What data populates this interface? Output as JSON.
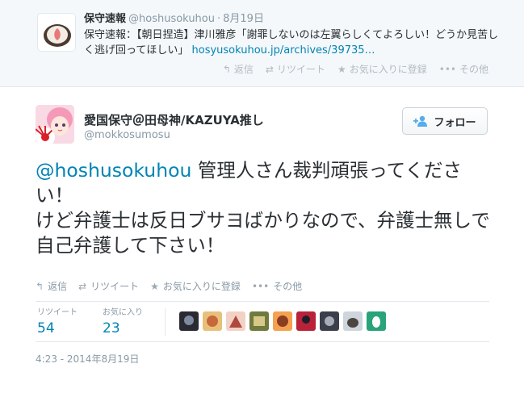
{
  "parent_tweet": {
    "name": "保守速報",
    "handle": "@hoshusokuhou",
    "separator": "·",
    "time": "8月19日",
    "text_before_link": "保守速報：【朝日捏造】津川雅彦「謝罪しないのは左翼らしくてよろしい！どうか見苦しく逃げ回ってほしい」",
    "link_text": "hosyusokuhou.jp/archives/39735…",
    "actions": {
      "reply": "返信",
      "retweet": "リツイート",
      "favorite": "お気に入りに登録",
      "more": "その他"
    }
  },
  "main_tweet": {
    "name": "愛国保守＠田母神/KAZUYA推し",
    "handle": "@mokkosumosu",
    "follow_label": "フォロー",
    "mention": "@hoshusokuhou",
    "text_after_mention": " 管理人さん裁判頑張ってください！",
    "text_line_2": "けど弁護士は反日ブサヨばかりなので、弁護士無しで自己弁護して下さい！",
    "actions": {
      "reply": "返信",
      "retweet": "リツイート",
      "favorite": "お気に入りに登録",
      "more": "その他"
    },
    "stats": {
      "retweets_label": "リツイート",
      "retweets_count": "54",
      "favorites_label": "お気に入り",
      "favorites_count": "23"
    },
    "timestamp": "4:23 - 2014年8月19日"
  },
  "icons": {
    "reply": "reply-icon",
    "retweet": "retweet-icon",
    "favorite": "star-icon",
    "more": "more-dots-icon",
    "follow": "add-user-icon"
  },
  "colors": {
    "link": "#0084b4",
    "muted": "#8899a6",
    "text": "#292f33",
    "parent_bg": "#f5f8fa"
  }
}
